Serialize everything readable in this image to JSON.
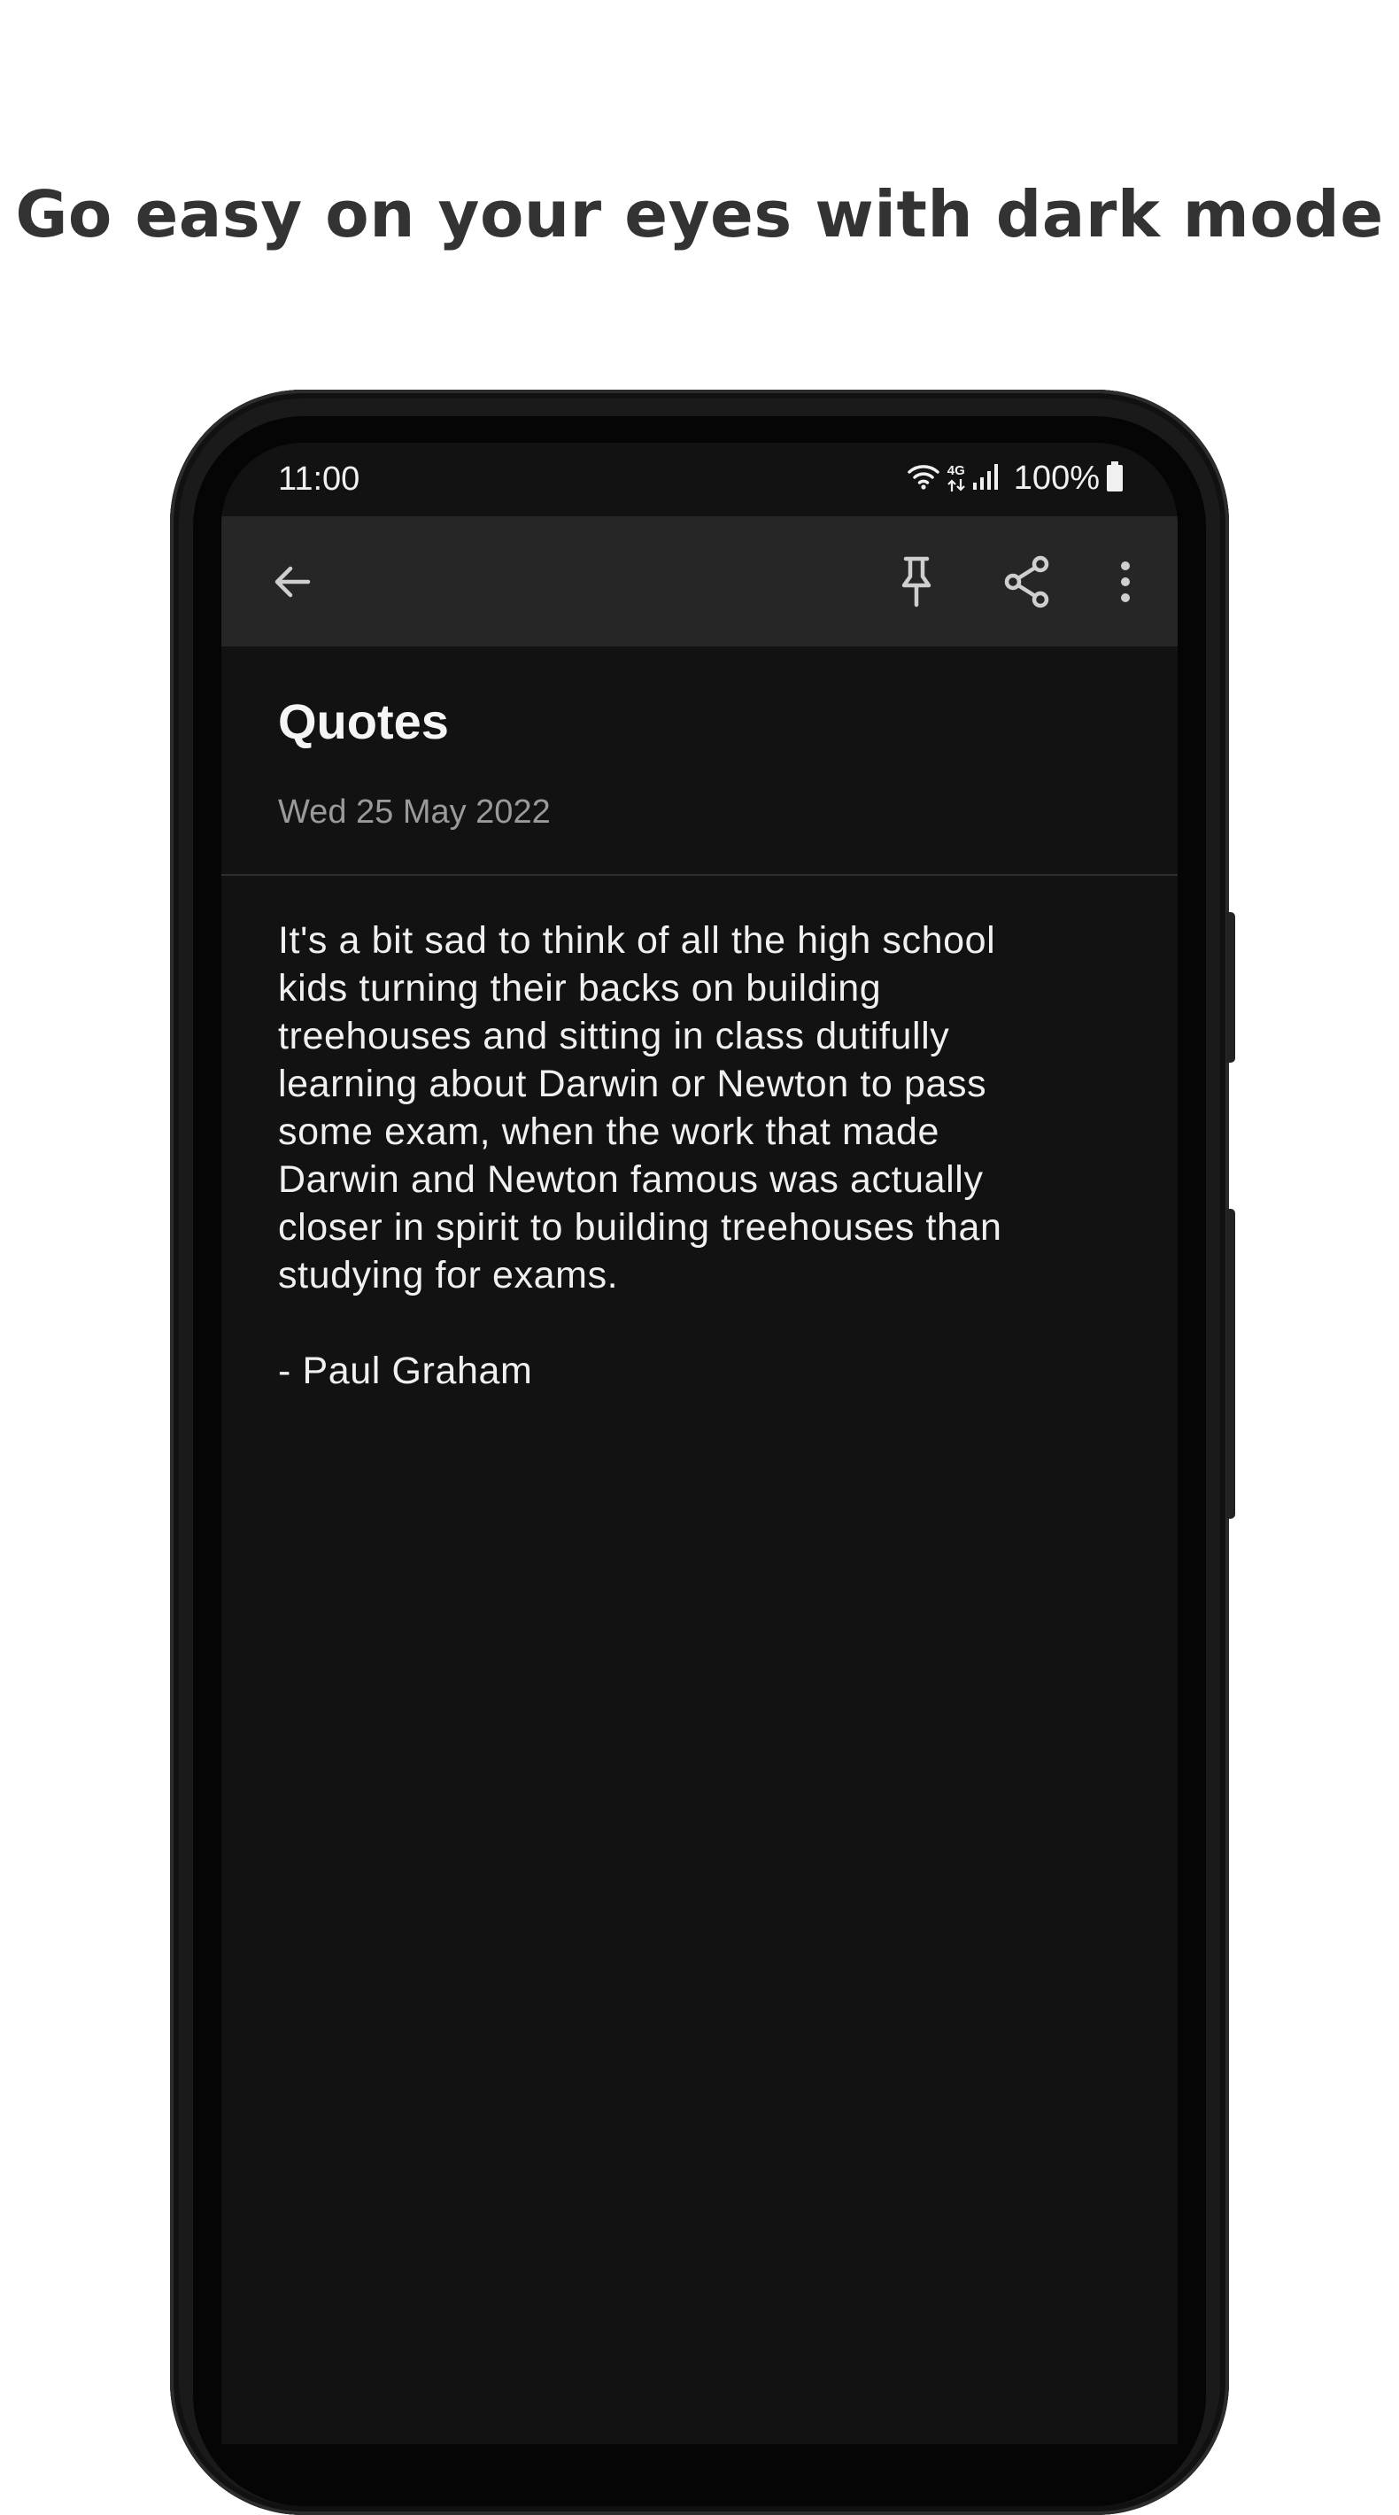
{
  "headline": "Go easy on your eyes with dark mode",
  "status_bar": {
    "time": "11:00",
    "network_type": "4G",
    "battery": "100%",
    "icons": [
      "wifi-icon",
      "mobile-data-icon",
      "signal-icon",
      "battery-icon"
    ]
  },
  "toolbar": {
    "icons": [
      "back-arrow-icon",
      "pin-icon",
      "share-icon",
      "more-vert-icon"
    ]
  },
  "note": {
    "title": "Quotes",
    "date": "Wed 25 May 2022",
    "body": "It's a bit sad to think of all the high school\nkids turning their backs on building\ntreehouses and sitting in class dutifully\nlearning about Darwin or Newton to pass\nsome exam, when the work that made\nDarwin and Newton famous was actually\ncloser in spirit to building treehouses than\nstudying for exams.\n\n- Paul Graham"
  },
  "colors": {
    "background": "#ffffff",
    "headline": "#333333",
    "screen": "#121212",
    "toolbar": "#262626",
    "text_primary": "#f0f0f0",
    "text_secondary": "#9a9a9a",
    "icon": "#cfcfcf"
  }
}
